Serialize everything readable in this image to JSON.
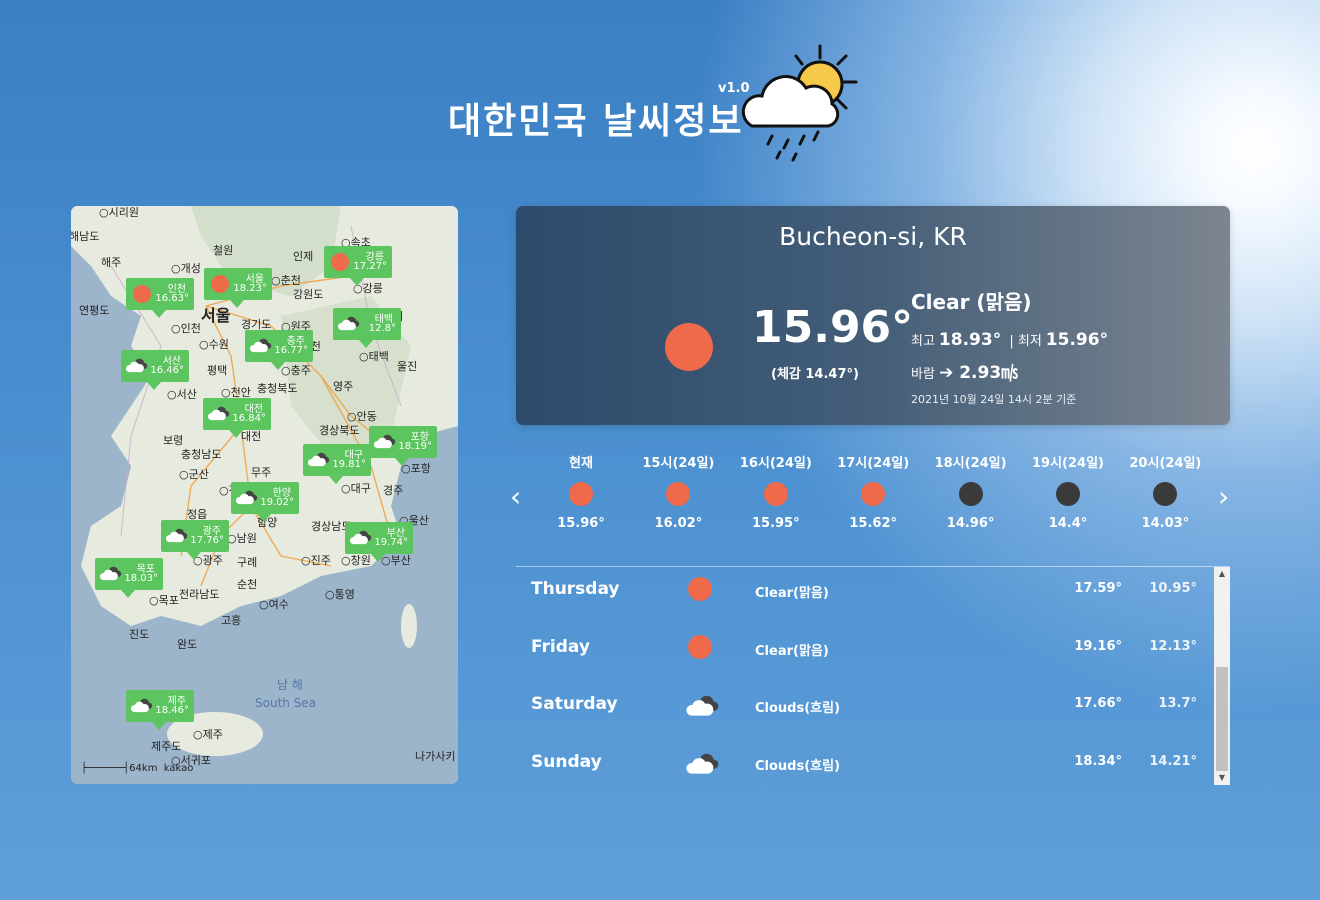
{
  "app": {
    "title": "대한민국 날씨정보",
    "version": "v1.0"
  },
  "colors": {
    "clear": "#ee6a4a",
    "night": "#3a3a3a",
    "marker": "#5dc55f"
  },
  "map": {
    "attribution": "kakao",
    "scale_label": "64km",
    "labels": [
      {
        "t": "○시리원"
      },
      {
        "t": "해남도"
      },
      {
        "t": "철원"
      },
      {
        "t": "인제"
      },
      {
        "t": "○속초"
      },
      {
        "t": "해주"
      },
      {
        "t": "○개성"
      },
      {
        "t": "○춘천"
      },
      {
        "t": "강원도"
      },
      {
        "t": "○강릉"
      },
      {
        "t": "연평도"
      },
      {
        "t": "서울"
      },
      {
        "t": "○인천"
      },
      {
        "t": "경기도"
      },
      {
        "t": "○수원"
      },
      {
        "t": "○원주"
      },
      {
        "t": "해"
      },
      {
        "t": "○제천"
      },
      {
        "t": "○충주"
      },
      {
        "t": "○태백"
      },
      {
        "t": "울진"
      },
      {
        "t": "평택"
      },
      {
        "t": "○서산"
      },
      {
        "t": "○천안"
      },
      {
        "t": "충청북도"
      },
      {
        "t": "영주"
      },
      {
        "t": "○안동"
      },
      {
        "t": "보령"
      },
      {
        "t": "대전"
      },
      {
        "t": "경상북도"
      },
      {
        "t": "충청남도"
      },
      {
        "t": "○군산"
      },
      {
        "t": "무주"
      },
      {
        "t": "○포항"
      },
      {
        "t": "○전주"
      },
      {
        "t": "○대구"
      },
      {
        "t": "경주"
      },
      {
        "t": "정읍"
      },
      {
        "t": "○울산"
      },
      {
        "t": "함양"
      },
      {
        "t": "경상남도"
      },
      {
        "t": "○남원"
      },
      {
        "t": "○광주"
      },
      {
        "t": "구례"
      },
      {
        "t": "○진주"
      },
      {
        "t": "○창원"
      },
      {
        "t": "○부산"
      },
      {
        "t": "순천"
      },
      {
        "t": "○목포"
      },
      {
        "t": "전라남도"
      },
      {
        "t": "○여수"
      },
      {
        "t": "○통영"
      },
      {
        "t": "고흥"
      },
      {
        "t": "진도"
      },
      {
        "t": "완도"
      },
      {
        "t": "남 해"
      },
      {
        "t": "South Sea"
      },
      {
        "t": "○제주"
      },
      {
        "t": "제주도"
      },
      {
        "t": "○서귀포"
      },
      {
        "t": "나가사키"
      }
    ],
    "markers": [
      {
        "name": "인천",
        "temp": "16.63°",
        "icon": "sun"
      },
      {
        "name": "서울",
        "temp": "18.23°",
        "icon": "sun"
      },
      {
        "name": "강릉",
        "temp": "17.27°",
        "icon": "sun"
      },
      {
        "name": "태백",
        "temp": "12.8°",
        "icon": "cloud"
      },
      {
        "name": "충주",
        "temp": "16.77°",
        "icon": "cloud"
      },
      {
        "name": "서산",
        "temp": "16.46°",
        "icon": "cloud"
      },
      {
        "name": "대전",
        "temp": "16.84°",
        "icon": "cloud"
      },
      {
        "name": "포항",
        "temp": "18.19°",
        "icon": "cloud"
      },
      {
        "name": "대구",
        "temp": "19.81°",
        "icon": "cloud"
      },
      {
        "name": "한양",
        "temp": "19.02°",
        "icon": "cloud"
      },
      {
        "name": "광주",
        "temp": "17.76°",
        "icon": "cloud"
      },
      {
        "name": "부산",
        "temp": "19.74°",
        "icon": "cloud"
      },
      {
        "name": "목포",
        "temp": "18.03°",
        "icon": "cloud"
      },
      {
        "name": "제주",
        "temp": "18.46°",
        "icon": "cloud"
      }
    ]
  },
  "current": {
    "city": "Bucheon-si, KR",
    "temp": "15.96°",
    "feels": "(체감 14.47°)",
    "desc": "Clear (맑음)",
    "max_label": "최고",
    "max": "18.93°",
    "sep": "|",
    "min_label": "최저",
    "min": "15.96°",
    "wind_label": "바람",
    "wind": "➔ 2.93㎧",
    "timestamp": "2021년 10월 24일 14시 2분 기준"
  },
  "hourly": [
    {
      "label": "현재",
      "temp": "15.96°",
      "icon": "clear-day"
    },
    {
      "label": "15시(24일)",
      "temp": "16.02°",
      "icon": "clear-day"
    },
    {
      "label": "16시(24일)",
      "temp": "15.95°",
      "icon": "clear-day"
    },
    {
      "label": "17시(24일)",
      "temp": "15.62°",
      "icon": "clear-day"
    },
    {
      "label": "18시(24일)",
      "temp": "14.96°",
      "icon": "clear-night"
    },
    {
      "label": "19시(24일)",
      "temp": "14.4°",
      "icon": "clear-night"
    },
    {
      "label": "20시(24일)",
      "temp": "14.03°",
      "icon": "clear-night"
    }
  ],
  "daily": [
    {
      "day": "Thursday",
      "desc": "Clear(맑음)",
      "max": "17.59°",
      "min": "10.95°",
      "icon": "sun"
    },
    {
      "day": "Friday",
      "desc": "Clear(맑음)",
      "max": "19.16°",
      "min": "12.13°",
      "icon": "sun"
    },
    {
      "day": "Saturday",
      "desc": "Clouds(흐림)",
      "max": "17.66°",
      "min": "13.7°",
      "icon": "cloud"
    },
    {
      "day": "Sunday",
      "desc": "Clouds(흐림)",
      "max": "18.34°",
      "min": "14.21°",
      "icon": "cloud"
    }
  ],
  "nav": {
    "prev_icon": "chevron-left-icon",
    "next_icon": "chevron-right-icon"
  }
}
